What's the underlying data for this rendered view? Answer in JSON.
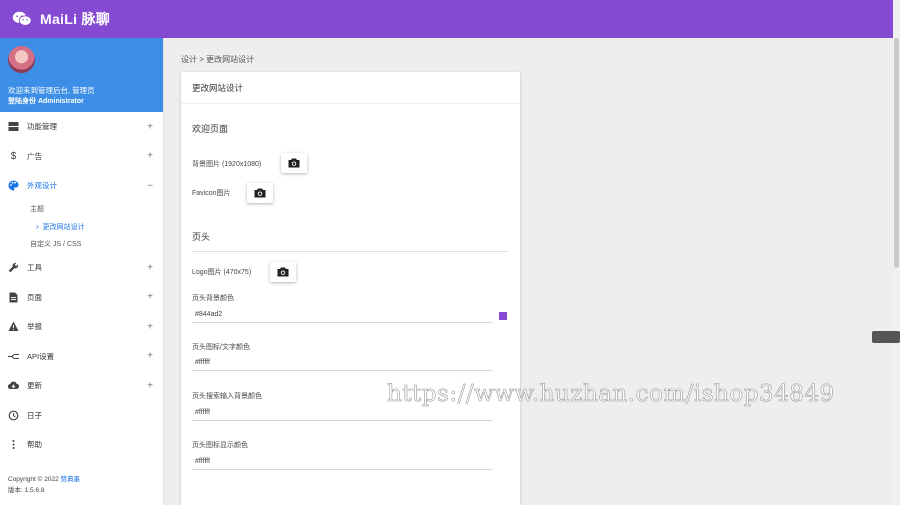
{
  "app": {
    "title": "MaiLi 脉聊"
  },
  "profile": {
    "welcome": "欢迎来到管理后台, 管理员",
    "role": "登陆身份 Administrator"
  },
  "sidebar": {
    "items": [
      {
        "label": "功能管理",
        "icon": "storage-icon",
        "toggle": "+"
      },
      {
        "label": "广告",
        "icon": "dollar-icon",
        "toggle": "+"
      },
      {
        "label": "外观设计",
        "icon": "palette-icon",
        "toggle": "−"
      },
      {
        "label": "工具",
        "icon": "wrench-icon",
        "toggle": "+"
      },
      {
        "label": "页面",
        "icon": "document-icon",
        "toggle": "+"
      },
      {
        "label": "举报",
        "icon": "warning-icon",
        "toggle": "+"
      },
      {
        "label": "API设置",
        "icon": "api-icon",
        "toggle": "+"
      },
      {
        "label": "更新",
        "icon": "cloud-download-icon",
        "toggle": "+"
      },
      {
        "label": "日子",
        "icon": "history-icon",
        "toggle": ""
      },
      {
        "label": "帮助",
        "icon": "more-vertical-icon",
        "toggle": ""
      }
    ],
    "submenu": {
      "theme": "主题",
      "edit_site": "更改网站设计",
      "custom_js_css": "自定义 JS / CSS"
    }
  },
  "footer": {
    "copyright": "Copyright © 2022",
    "company": "赞典墨",
    "version": "版本: 1.5.6.8"
  },
  "breadcrumb": "设计 > 更改网站设计",
  "card": {
    "title": "更改网站设计",
    "welcome_section": "欢迎页面",
    "background_label": "背景图片 (1920x1080)",
    "favicon_label": "Favicon图片",
    "header_section": "页头",
    "logo_label": "Logo图片 (470x75)",
    "header_bg_label": "页头背景颜色",
    "header_bg_value": "#844ad2",
    "header_icon_text_label": "页头图标/文字颜色",
    "header_icon_text_value": "#ffffff",
    "header_search_bg_label": "页头搜索输入背景颜色",
    "header_search_bg_value": "#ffffff",
    "header_icon_display_label": "页头图标显示颜色",
    "header_icon_display_value": "#ffffff"
  },
  "colors": {
    "header": "#844ad2",
    "profile": "#3c8ee6",
    "accent": "#1a73e8"
  },
  "watermark": "https://www.huzhan.com/ishop34849"
}
